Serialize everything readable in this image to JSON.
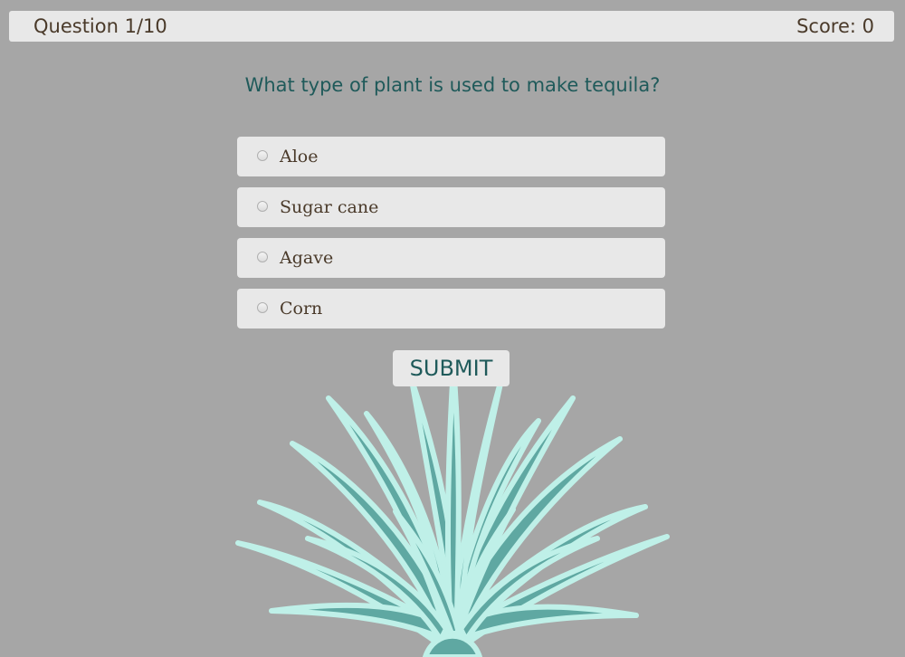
{
  "header": {
    "question_counter": "Question 1/10",
    "score": "Score: 0"
  },
  "question": {
    "text": "What type of plant is used to make tequila?"
  },
  "options": [
    {
      "label": "Aloe",
      "selected": false
    },
    {
      "label": "Sugar cane",
      "selected": false
    },
    {
      "label": "Agave",
      "selected": false
    },
    {
      "label": "Corn",
      "selected": false
    }
  ],
  "submit": {
    "label": "SUBMIT"
  },
  "illustration": {
    "icon": "agave-plant-icon",
    "fill_color": "#5fa8a2",
    "outline_color": "#bff0e8"
  },
  "colors": {
    "background": "#a6a6a6",
    "panel": "#e8e8e8",
    "accent_text": "#1f5a5a",
    "body_text": "#4a3a2a"
  }
}
